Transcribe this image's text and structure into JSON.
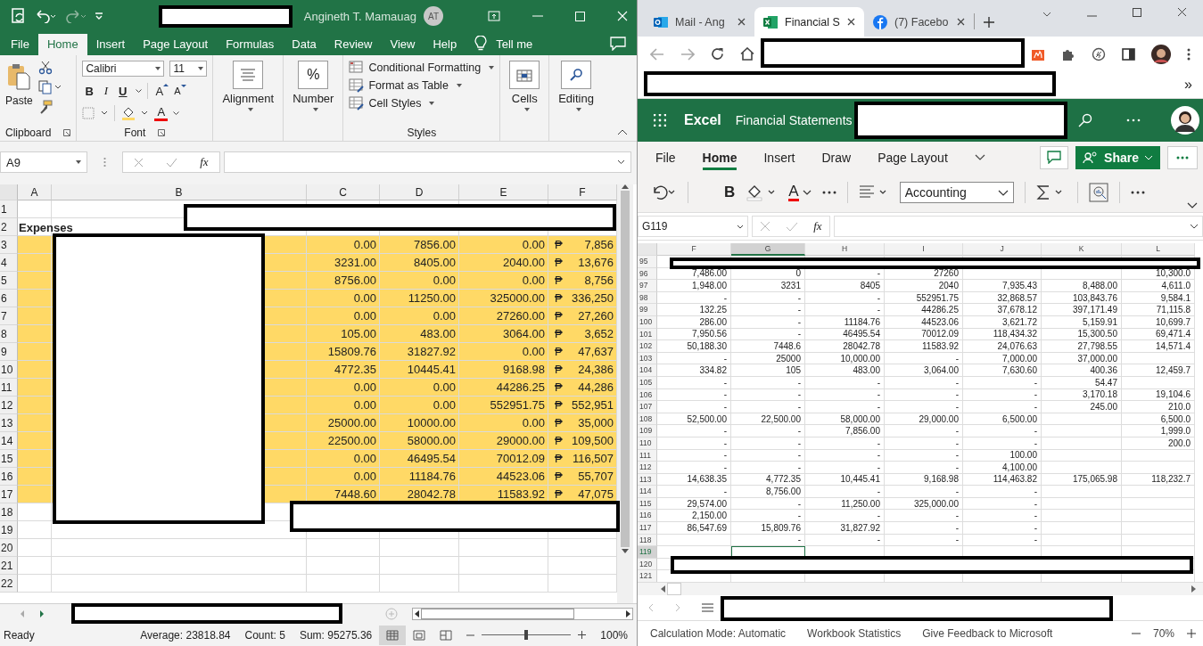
{
  "excel_desktop": {
    "title_bar": {
      "user_name": "Angineth T. Mamauag",
      "user_initials": "AT"
    },
    "ribbon_tabs": [
      {
        "label": "File",
        "selected": false
      },
      {
        "label": "Home",
        "selected": true
      },
      {
        "label": "Insert",
        "selected": false
      },
      {
        "label": "Page Layout",
        "selected": false
      },
      {
        "label": "Formulas",
        "selected": false
      },
      {
        "label": "Data",
        "selected": false
      },
      {
        "label": "Review",
        "selected": false
      },
      {
        "label": "View",
        "selected": false
      },
      {
        "label": "Help",
        "selected": false
      }
    ],
    "tell_me": "Tell me",
    "ribbon": {
      "paste": "Paste",
      "clipboard_label": "Clipboard",
      "font_name": "Calibri",
      "font_size": "11",
      "bold": "B",
      "italic": "I",
      "underline": "U",
      "grow_font": "A",
      "shrink_font": "A",
      "font_color": "A",
      "font_label": "Font",
      "alignment": "Alignment",
      "number": "Number",
      "number_symbol": "%",
      "styles": [
        "Conditional Formatting",
        "Format as Table",
        "Cell Styles"
      ],
      "styles_label": "Styles",
      "cells": "Cells",
      "editing": "Editing"
    },
    "formula_bar": {
      "name_box": "A9",
      "function_label": "fx"
    },
    "columns": [
      "A",
      "B",
      "C",
      "D",
      "E",
      "F"
    ],
    "rows": [
      {
        "number": "1"
      },
      {
        "number": "2",
        "label": "Expenses"
      },
      {
        "number": "3",
        "highlighted": true,
        "values": [
          "0.00",
          "7856.00",
          "0.00"
        ],
        "currency_symbol": "₱",
        "total": "7,856"
      },
      {
        "number": "4",
        "highlighted": true,
        "values": [
          "3231.00",
          "8405.00",
          "2040.00"
        ],
        "currency_symbol": "₱",
        "total": "13,676"
      },
      {
        "number": "5",
        "highlighted": true,
        "values": [
          "8756.00",
          "0.00",
          "0.00"
        ],
        "currency_symbol": "₱",
        "total": "8,756"
      },
      {
        "number": "6",
        "highlighted": true,
        "values": [
          "0.00",
          "11250.00",
          "325000.00"
        ],
        "currency_symbol": "₱",
        "total": "336,250"
      },
      {
        "number": "7",
        "highlighted": true,
        "values": [
          "0.00",
          "0.00",
          "27260.00"
        ],
        "currency_symbol": "₱",
        "total": "27,260"
      },
      {
        "number": "8",
        "highlighted": true,
        "values": [
          "105.00",
          "483.00",
          "3064.00"
        ],
        "currency_symbol": "₱",
        "total": "3,652"
      },
      {
        "number": "9",
        "highlighted": true,
        "values": [
          "15809.76",
          "31827.92",
          "0.00"
        ],
        "currency_symbol": "₱",
        "total": "47,637"
      },
      {
        "number": "10",
        "highlighted": true,
        "values": [
          "4772.35",
          "10445.41",
          "9168.98"
        ],
        "currency_symbol": "₱",
        "total": "24,386"
      },
      {
        "number": "11",
        "highlighted": true,
        "values": [
          "0.00",
          "0.00",
          "44286.25"
        ],
        "currency_symbol": "₱",
        "total": "44,286"
      },
      {
        "number": "12",
        "highlighted": true,
        "values": [
          "0.00",
          "0.00",
          "552951.75"
        ],
        "currency_symbol": "₱",
        "total": "552,951"
      },
      {
        "number": "13",
        "highlighted": true,
        "values": [
          "25000.00",
          "10000.00",
          "0.00"
        ],
        "currency_symbol": "₱",
        "total": "35,000"
      },
      {
        "number": "14",
        "highlighted": true,
        "values": [
          "22500.00",
          "58000.00",
          "29000.00"
        ],
        "currency_symbol": "₱",
        "total": "109,500"
      },
      {
        "number": "15",
        "highlighted": true,
        "values": [
          "0.00",
          "46495.54",
          "70012.09"
        ],
        "currency_symbol": "₱",
        "total": "116,507"
      },
      {
        "number": "16",
        "highlighted": true,
        "values": [
          "0.00",
          "11184.76",
          "44523.06"
        ],
        "currency_symbol": "₱",
        "total": "55,707"
      },
      {
        "number": "17",
        "highlighted": true,
        "values": [
          "7448.60",
          "28042.78",
          "11583.92"
        ],
        "currency_symbol": "₱",
        "total": "47,075"
      },
      {
        "number": "18"
      },
      {
        "number": "19"
      },
      {
        "number": "20"
      },
      {
        "number": "21"
      },
      {
        "number": "22"
      }
    ],
    "status_bar": {
      "mode": "Ready",
      "average": "Average: 23818.84",
      "count": "Count: 5",
      "sum": "Sum: 95275.36",
      "zoom": "100%",
      "zoom_slider": {
        "level": 0.5
      }
    }
  },
  "browser": {
    "tabs": [
      {
        "title": "Mail - Ang",
        "kind": "mail",
        "selected": false
      },
      {
        "title": "Financial S",
        "kind": "spreadsheet",
        "selected": true
      },
      {
        "title": "(7) Facebo",
        "kind": "social",
        "selected": false
      }
    ],
    "bookmarks_overflow": "»",
    "excel_web": {
      "app_name": "Excel",
      "document_title": "Financial Statements",
      "ribbon_tabs": [
        {
          "label": "File",
          "selected": false
        },
        {
          "label": "Home",
          "selected": true
        },
        {
          "label": "Insert",
          "selected": false
        },
        {
          "label": "Draw",
          "selected": false
        },
        {
          "label": "Page Layout",
          "selected": false
        }
      ],
      "share": "Share",
      "bold": "B",
      "font_color": "A",
      "number_format": "Accounting",
      "formula_bar": {
        "name_box": "G119",
        "function_label": "fx"
      },
      "columns": [
        {
          "label": "F",
          "selected": false
        },
        {
          "label": "G",
          "selected": true
        },
        {
          "label": "H",
          "selected": false
        },
        {
          "label": "I",
          "selected": false
        },
        {
          "label": "J",
          "selected": false
        },
        {
          "label": "K",
          "selected": false
        },
        {
          "label": "L",
          "selected": false
        }
      ],
      "rows": [
        {
          "number": "95",
          "selected": false
        },
        {
          "number": "96",
          "selected": false,
          "cells": [
            "7,486.00",
            "0",
            "-",
            "27260",
            null,
            null,
            "10,300.0"
          ]
        },
        {
          "number": "97",
          "selected": false,
          "cells": [
            "1,948.00",
            "3231",
            "8405",
            "2040",
            "7,935.43",
            "8,488.00",
            "4,611.0"
          ]
        },
        {
          "number": "98",
          "selected": false,
          "cells": [
            "-",
            "-",
            "-",
            "552951.75",
            "32,868.57",
            "103,843.76",
            "9,584.1"
          ]
        },
        {
          "number": "99",
          "selected": false,
          "cells": [
            "132.25",
            "-",
            "-",
            "44286.25",
            "37,678.12",
            "397,171.49",
            "71,115.8"
          ]
        },
        {
          "number": "100",
          "selected": false,
          "cells": [
            "286.00",
            "-",
            "11184.76",
            "44523.06",
            "3,621.72",
            "5,159.91",
            "10,699.7"
          ]
        },
        {
          "number": "101",
          "selected": false,
          "cells": [
            "7,950.56",
            "-",
            "46495.54",
            "70012.09",
            "118,434.32",
            "15,300.50",
            "69,471.4"
          ]
        },
        {
          "number": "102",
          "selected": false,
          "cells": [
            "50,188.30",
            "7448.6",
            "28042.78",
            "11583.92",
            "24,076.63",
            "27,798.55",
            "14,571.4"
          ]
        },
        {
          "number": "103",
          "selected": false,
          "cells": [
            "-",
            "25000",
            "10,000.00",
            "-",
            "7,000.00",
            "37,000.00",
            null
          ]
        },
        {
          "number": "104",
          "selected": false,
          "cells": [
            "334.82",
            "105",
            "483.00",
            "3,064.00",
            "7,630.60",
            "400.36",
            "12,459.7"
          ]
        },
        {
          "number": "105",
          "selected": false,
          "cells": [
            "-",
            "-",
            "-",
            "-",
            "-",
            "54.47",
            null
          ]
        },
        {
          "number": "106",
          "selected": false,
          "cells": [
            "-",
            "-",
            "-",
            "-",
            "-",
            "3,170.18",
            "19,104.6"
          ]
        },
        {
          "number": "107",
          "selected": false,
          "cells": [
            "-",
            "-",
            "-",
            "-",
            "-",
            "245.00",
            "210.0"
          ]
        },
        {
          "number": "108",
          "selected": false,
          "cells": [
            "52,500.00",
            "22,500.00",
            "58,000.00",
            "29,000.00",
            "6,500.00",
            null,
            "6,500.0"
          ]
        },
        {
          "number": "109",
          "selected": false,
          "cells": [
            "-",
            "-",
            "7,856.00",
            "-",
            "-",
            null,
            "1,999.0"
          ]
        },
        {
          "number": "110",
          "selected": false,
          "cells": [
            "-",
            "-",
            "-",
            "-",
            "-",
            null,
            "200.0"
          ]
        },
        {
          "number": "111",
          "selected": false,
          "cells": [
            "-",
            "-",
            "-",
            "-",
            "100.00",
            null,
            null
          ]
        },
        {
          "number": "112",
          "selected": false,
          "cells": [
            "-",
            "-",
            "-",
            "-",
            "4,100.00",
            null,
            null
          ]
        },
        {
          "number": "113",
          "selected": false,
          "cells": [
            "14,638.35",
            "4,772.35",
            "10,445.41",
            "9,168.98",
            "114,463.82",
            "175,065.98",
            "118,232.7"
          ]
        },
        {
          "number": "114",
          "selected": false,
          "cells": [
            "-",
            "8,756.00",
            "-",
            "-",
            "-",
            null,
            null
          ]
        },
        {
          "number": "115",
          "selected": false,
          "cells": [
            "29,574.00",
            "-",
            "11,250.00",
            "325,000.00",
            "-",
            null,
            null
          ]
        },
        {
          "number": "116",
          "selected": false,
          "cells": [
            "2,150.00",
            "-",
            "-",
            "-",
            "-",
            null,
            null
          ]
        },
        {
          "number": "117",
          "selected": false,
          "cells": [
            "86,547.69",
            "15,809.76",
            "31,827.92",
            "-",
            "-",
            null,
            null
          ]
        },
        {
          "number": "118",
          "selected": false,
          "cells": [
            null,
            "-",
            "-",
            "-",
            "-",
            null,
            null
          ]
        },
        {
          "number": "119",
          "selected": true
        },
        {
          "number": "120",
          "selected": false
        },
        {
          "number": "121",
          "selected": false
        }
      ],
      "status_bar": {
        "calculation": "Calculation Mode: Automatic",
        "statistics": "Workbook Statistics",
        "feedback": "Give Feedback to Microsoft",
        "zoom": "70%"
      }
    }
  }
}
